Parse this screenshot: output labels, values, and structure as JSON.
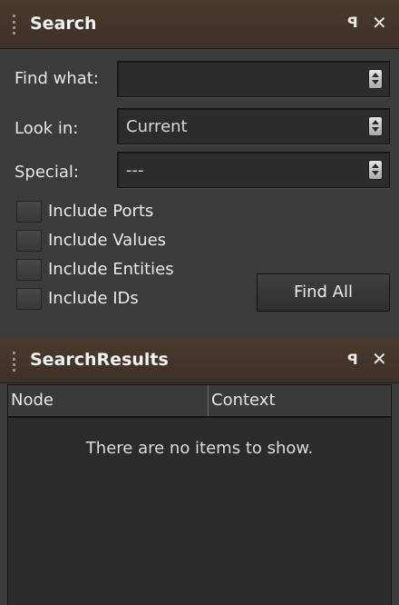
{
  "search_panel": {
    "title": "Search",
    "pin_symbol": "§",
    "close_symbol": "✕",
    "find_what": {
      "label": "Find what:",
      "value": ""
    },
    "look_in": {
      "label": "Look in:",
      "value": "Current"
    },
    "special": {
      "label": "Special:",
      "value": "---"
    },
    "options": [
      {
        "label": "Include Ports",
        "checked": false
      },
      {
        "label": "Include Values",
        "checked": false
      },
      {
        "label": "Include Entities",
        "checked": false
      },
      {
        "label": "Include IDs",
        "checked": false
      }
    ],
    "find_all_label": "Find All"
  },
  "results_panel": {
    "title": "SearchResults",
    "columns": [
      "Node",
      "Context"
    ],
    "empty_message": "There are no items to show."
  },
  "icons": {
    "grip": "drag-grip-icon",
    "pin": "pin-icon",
    "close": "close-icon",
    "dropdown": "updown-arrow-icon"
  },
  "colors": {
    "header_bg": "#45362b",
    "panel_bg": "#3b3b3b",
    "field_bg": "#2c2c2c"
  }
}
